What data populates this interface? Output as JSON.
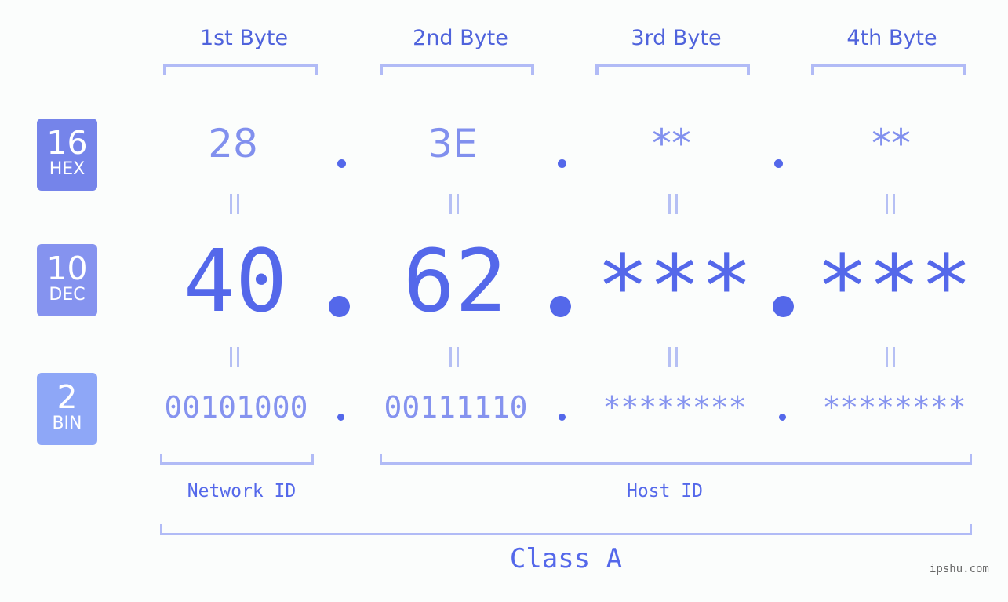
{
  "bytes": [
    {
      "header": "1st Byte",
      "hex": "28",
      "dec": "40",
      "bin": "00101000"
    },
    {
      "header": "2nd Byte",
      "hex": "3E",
      "dec": "62",
      "bin": "00111110"
    },
    {
      "header": "3rd Byte",
      "hex": "**",
      "dec": "***",
      "bin": "********"
    },
    {
      "header": "4th Byte",
      "hex": "**",
      "dec": "***",
      "bin": "********"
    }
  ],
  "bases": [
    {
      "num": "16",
      "label": "HEX",
      "color": "#7584ea"
    },
    {
      "num": "10",
      "label": "DEC",
      "color": "#8593ef"
    },
    {
      "num": "2",
      "label": "BIN",
      "color": "#8ea7f7"
    }
  ],
  "segments": {
    "network": "Network ID",
    "host": "Host ID"
  },
  "class_label": "Class A",
  "watermark": "ipshu.com"
}
